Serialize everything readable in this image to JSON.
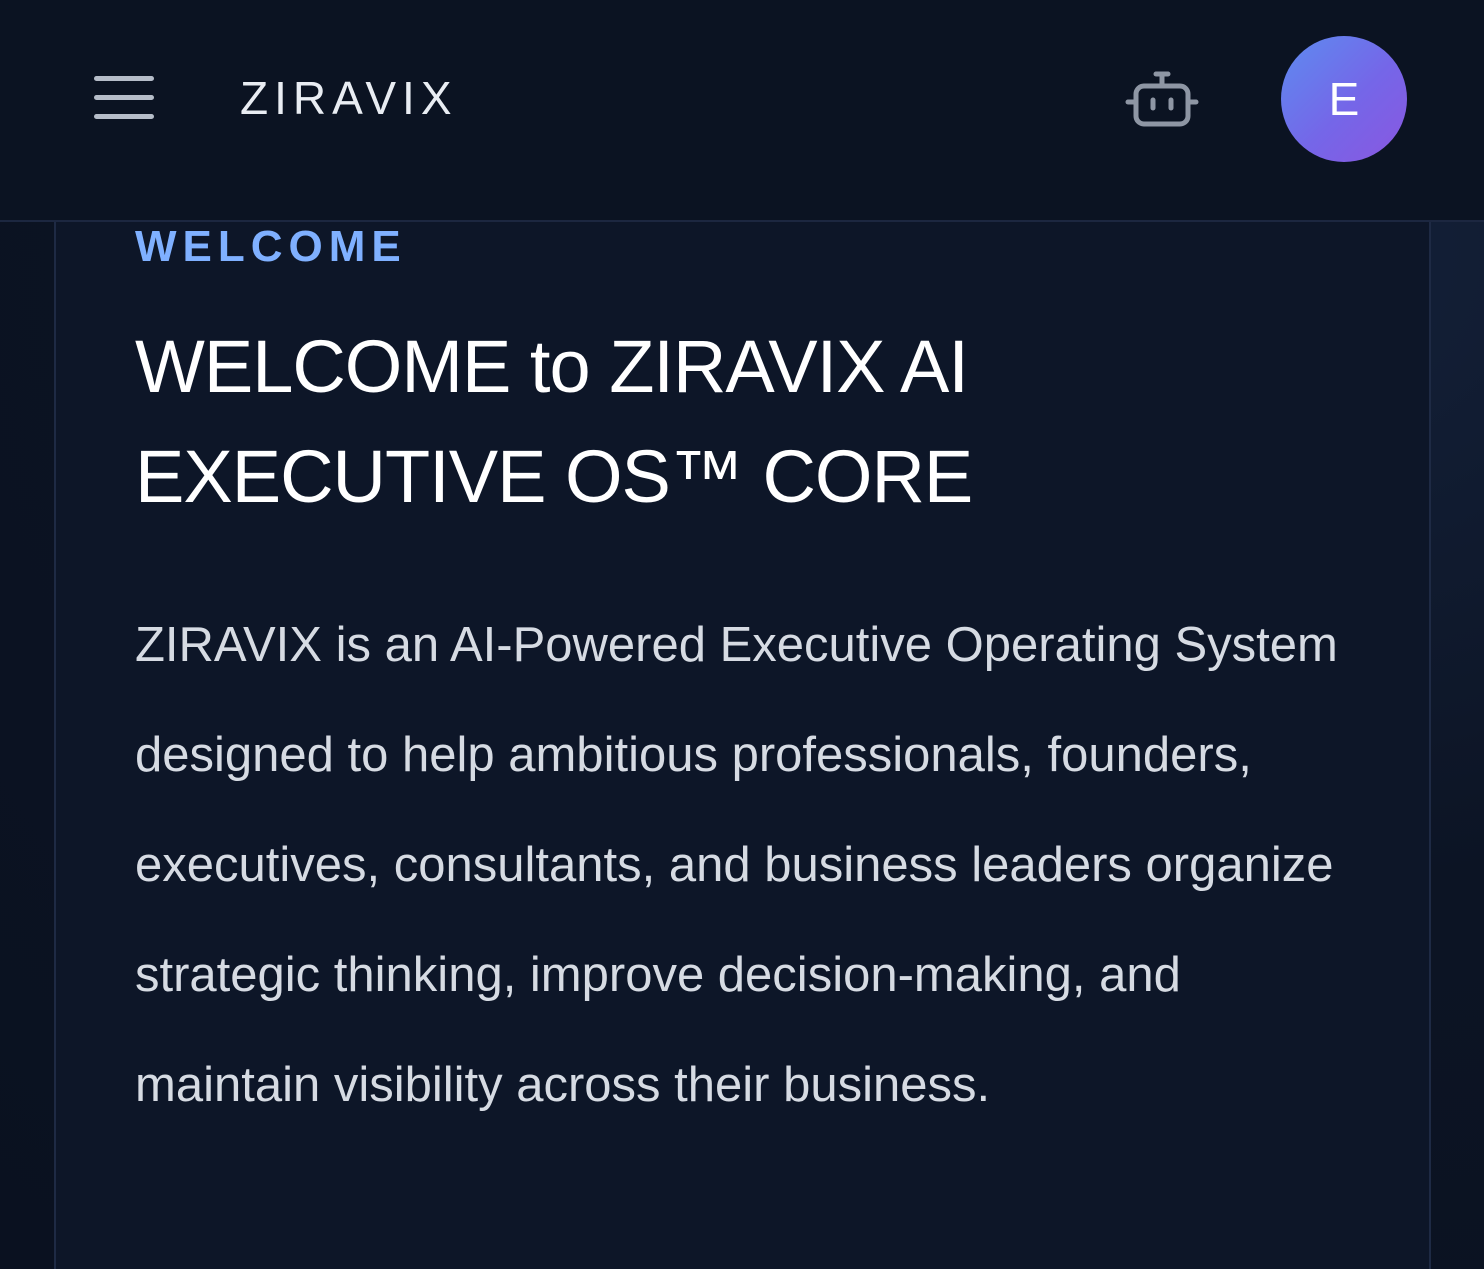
{
  "header": {
    "menu_icon": "hamburger-menu-icon",
    "brand": "ZIRAVIX",
    "assistant_icon": "robot-icon",
    "avatar_initial": "E"
  },
  "welcome_card": {
    "eyebrow": "WELCOME",
    "title": "WELCOME to ZIRAVIX AI EXECUTIVE OS™ CORE",
    "description": "ZIRAVIX is an AI-Powered Executive Operating System designed to help ambitious professionals, founders, executives, consultants, and business leaders organize strategic thinking, improve decision-making, and maintain visibility across their business."
  },
  "colors": {
    "background": "#0b1220",
    "accent_blue": "#7fb0ff",
    "avatar_gradient_start": "#5d8cf0",
    "avatar_gradient_end": "#8a57e0"
  }
}
